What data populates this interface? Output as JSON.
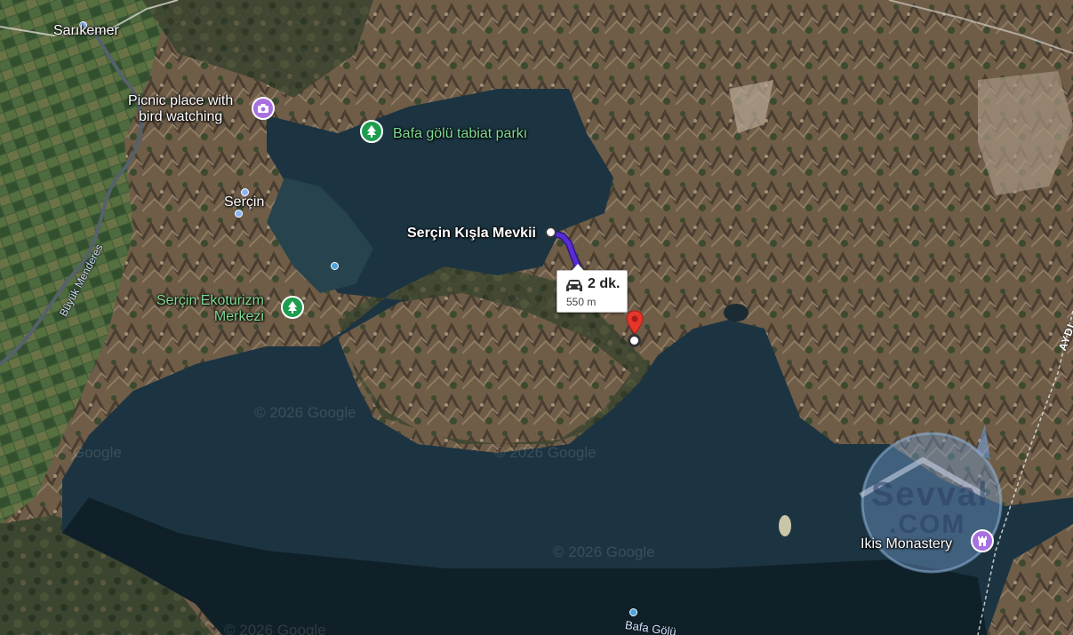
{
  "map": {
    "type": "satellite",
    "places": {
      "sarikemer": "Sarıkemer",
      "picnic_line1": "Picnic place with",
      "picnic_line2": "bird watching",
      "bafa_park": "Bafa gölü tabiat parkı",
      "sercin": "Serçin",
      "kisla": "Serçin Kışla Mevkii",
      "ekoturizm_line1": "Serçin Ekoturizm",
      "ekoturizm_line2": "Merkezi",
      "ikis": "Ikis Monastery",
      "bafa_bottom": "Bafa Gölü"
    },
    "river_label": "Büyük Menderes",
    "road_label": "AYDI",
    "route": {
      "time": "2 dk.",
      "distance": "550 m",
      "color": "#5b2bd6"
    },
    "watermarks": [
      "© 2026 Google",
      "© 2026 Google",
      "© 2026 Google",
      "© 2026 Google",
      "Google"
    ],
    "overlay_logo": [
      "Sevval",
      ".COM"
    ],
    "icons": {
      "park": "tree-icon",
      "photo": "camera-icon",
      "monastery": "castle-icon",
      "destination": "red-pin-icon",
      "car": "car-icon"
    }
  }
}
